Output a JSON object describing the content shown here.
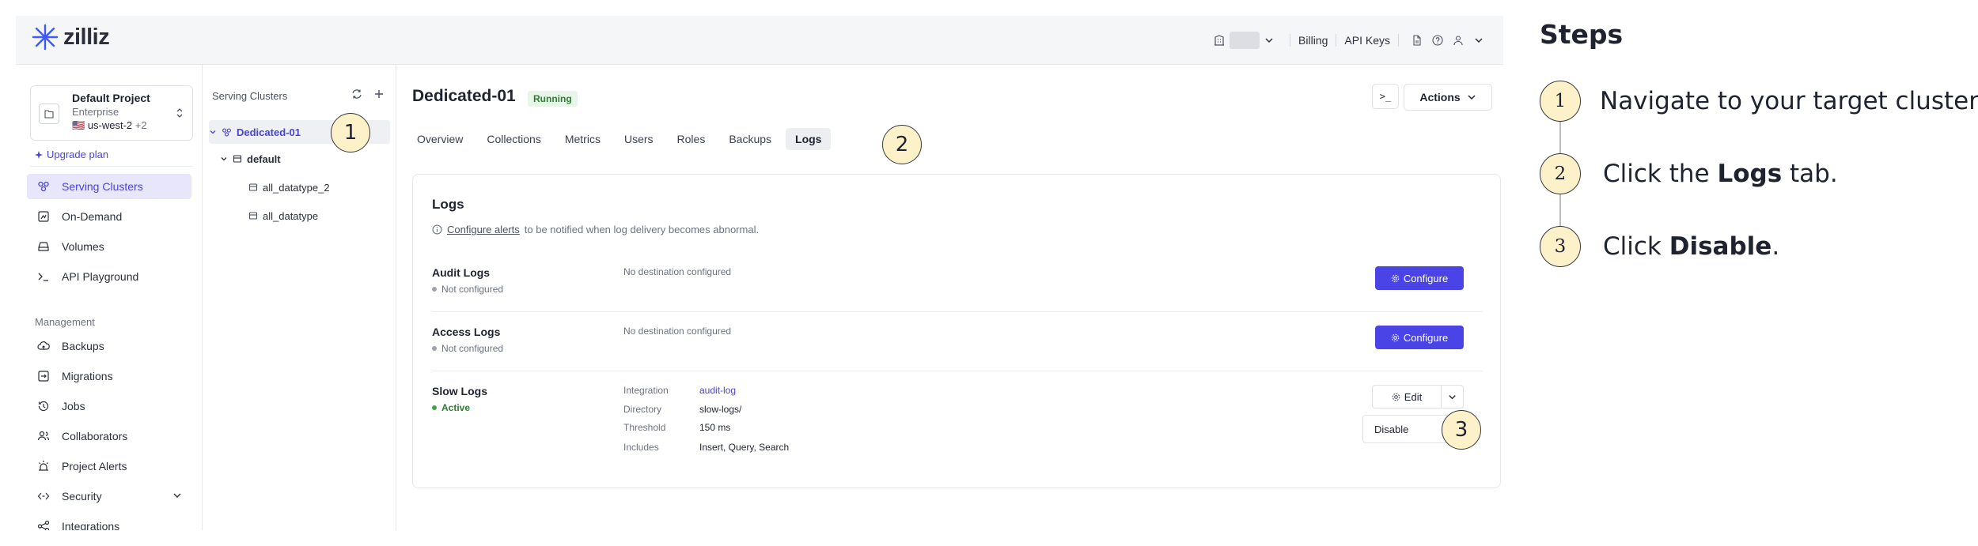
{
  "app": {
    "brand": "zilliz",
    "colors": {
      "accent": "#4a44e6",
      "active_nav_bg": "#e7e6fb",
      "running": "#2e7d32",
      "marker": "#fdf1c9"
    }
  },
  "topbar": {
    "billing": "Billing",
    "api_keys": "API Keys",
    "icons": [
      "building-icon",
      "chevron-down-icon",
      "document-icon",
      "help-icon",
      "user-icon"
    ]
  },
  "project": {
    "name": "Default Project",
    "plan": "Enterprise",
    "region": "us-west-2",
    "region_extra": "+2",
    "upgrade": "Upgrade plan"
  },
  "nav": {
    "items": [
      {
        "label": "Serving Clusters",
        "icon": "clusters-icon",
        "active": true
      },
      {
        "label": "On-Demand",
        "icon": "on-demand-icon"
      },
      {
        "label": "Volumes",
        "icon": "volume-icon"
      },
      {
        "label": "API Playground",
        "icon": "terminal-icon"
      }
    ],
    "management_label": "Management",
    "management": [
      {
        "label": "Backups",
        "icon": "cloud-icon"
      },
      {
        "label": "Migrations",
        "icon": "migration-icon"
      },
      {
        "label": "Jobs",
        "icon": "history-icon"
      },
      {
        "label": "Collaborators",
        "icon": "users-icon"
      },
      {
        "label": "Project Alerts",
        "icon": "alarm-icon"
      },
      {
        "label": "Security",
        "icon": "security-icon",
        "expandable": true
      },
      {
        "label": "Integrations",
        "icon": "integrations-icon"
      }
    ]
  },
  "tree": {
    "header": "Serving Clusters",
    "cluster": "Dedicated-01",
    "database": "default",
    "collections": [
      "all_datatype_2",
      "all_datatype"
    ]
  },
  "main": {
    "title": "Dedicated-01",
    "status": "Running",
    "terminal_label": ">_",
    "actions": "Actions",
    "tabs": [
      "Overview",
      "Collections",
      "Metrics",
      "Users",
      "Roles",
      "Backups",
      "Logs"
    ],
    "active_tab": "Logs"
  },
  "logs": {
    "title": "Logs",
    "note_link": "Configure alerts",
    "note_rest": "to be notified when log delivery becomes abnormal.",
    "audit": {
      "name": "Audit Logs",
      "status": "Not configured",
      "destination": "No destination configured",
      "button": "Configure"
    },
    "access": {
      "name": "Access Logs",
      "status": "Not configured",
      "destination": "No destination configured",
      "button": "Configure"
    },
    "slow": {
      "name": "Slow Logs",
      "status": "Active",
      "fields": [
        {
          "key": "Integration",
          "value": "audit-log",
          "link": true
        },
        {
          "key": "Directory",
          "value": "slow-logs/"
        },
        {
          "key": "Threshold",
          "value": "150 ms"
        },
        {
          "key": "Includes",
          "value": "Insert, Query, Search"
        }
      ],
      "edit": "Edit",
      "disable": "Disable"
    }
  },
  "markers": [
    "1",
    "2",
    "3"
  ],
  "steps": {
    "title": "Steps",
    "items": [
      {
        "num": "1",
        "before": "Navigate to your target cluster.",
        "bold": "",
        "after": ""
      },
      {
        "num": "2",
        "before": "Click the ",
        "bold": "Logs",
        "after": " tab."
      },
      {
        "num": "3",
        "before": "Click ",
        "bold": "Disable",
        "after": "."
      }
    ]
  }
}
